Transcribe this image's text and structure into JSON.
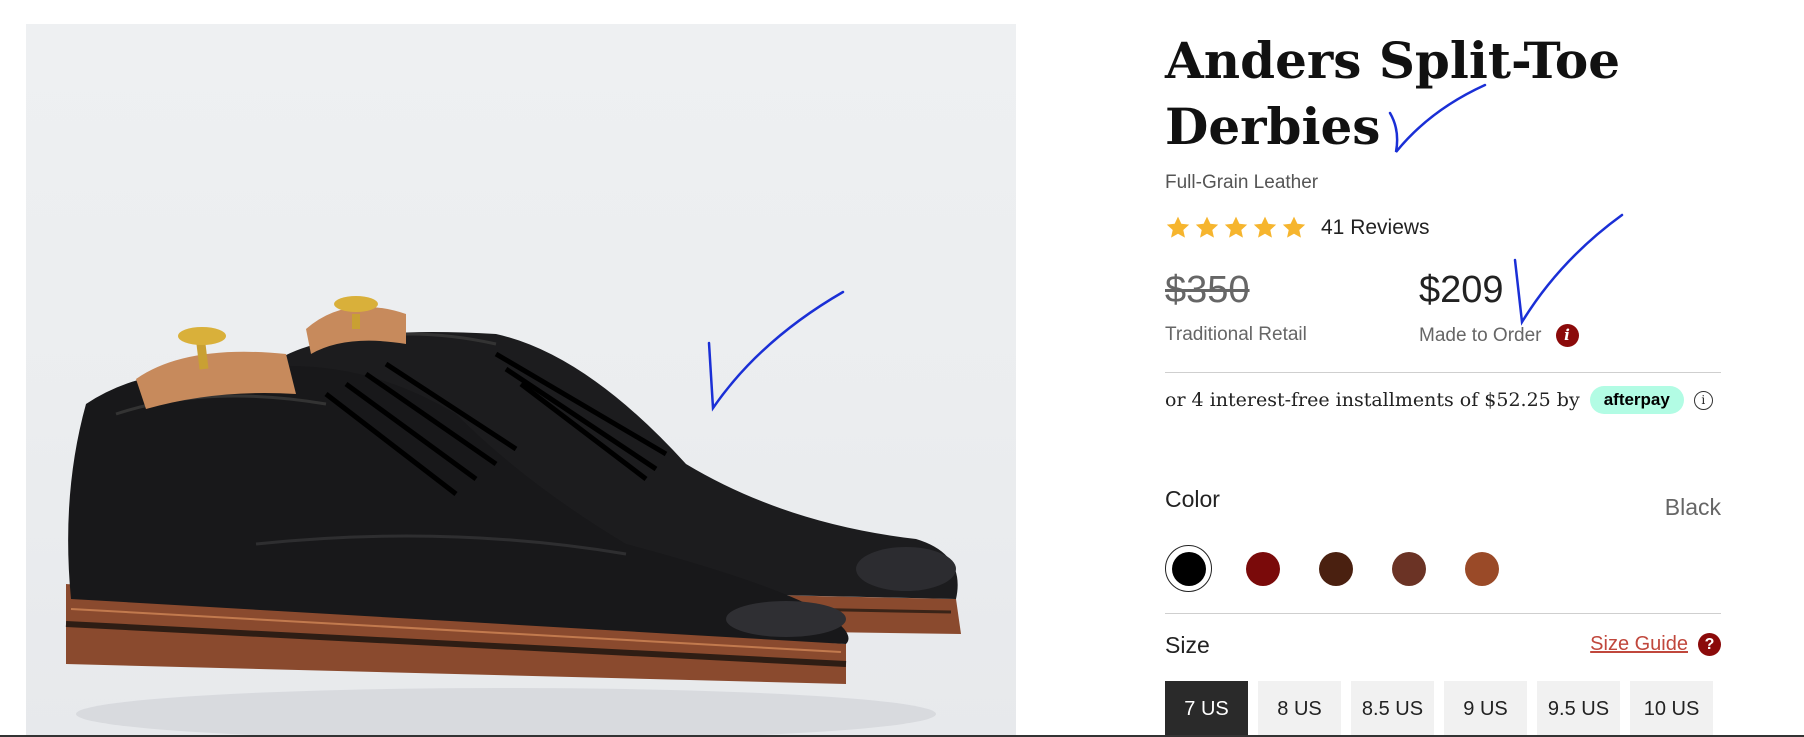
{
  "product": {
    "title": "Anders Split-Toe Derbies",
    "subtitle": "Full-Grain Leather",
    "rating": 5,
    "reviews": "41 Reviews",
    "retail_price": "$350",
    "retail_label": "Traditional Retail",
    "price": "$209",
    "price_label": "Made to Order"
  },
  "afterpay": {
    "text": "or 4 interest-free installments of $52.25 by",
    "badge": "afterpay"
  },
  "color": {
    "label": "Color",
    "selected": "Black",
    "swatches": [
      "#000000",
      "#7a0a0a",
      "#4a2010",
      "#6b3325",
      "#9a4a28"
    ]
  },
  "size": {
    "label": "Size",
    "guide": "Size Guide",
    "options": [
      "7 US",
      "8 US",
      "8.5 US",
      "9 US",
      "9.5 US",
      "10 US"
    ],
    "selected": "7 US"
  },
  "colors": {
    "star": "#f6b52e",
    "accent": "#8b0a0a",
    "link": "#c0473c",
    "afterpay": "#b2fce4",
    "annotation": "#1a2fd6"
  }
}
